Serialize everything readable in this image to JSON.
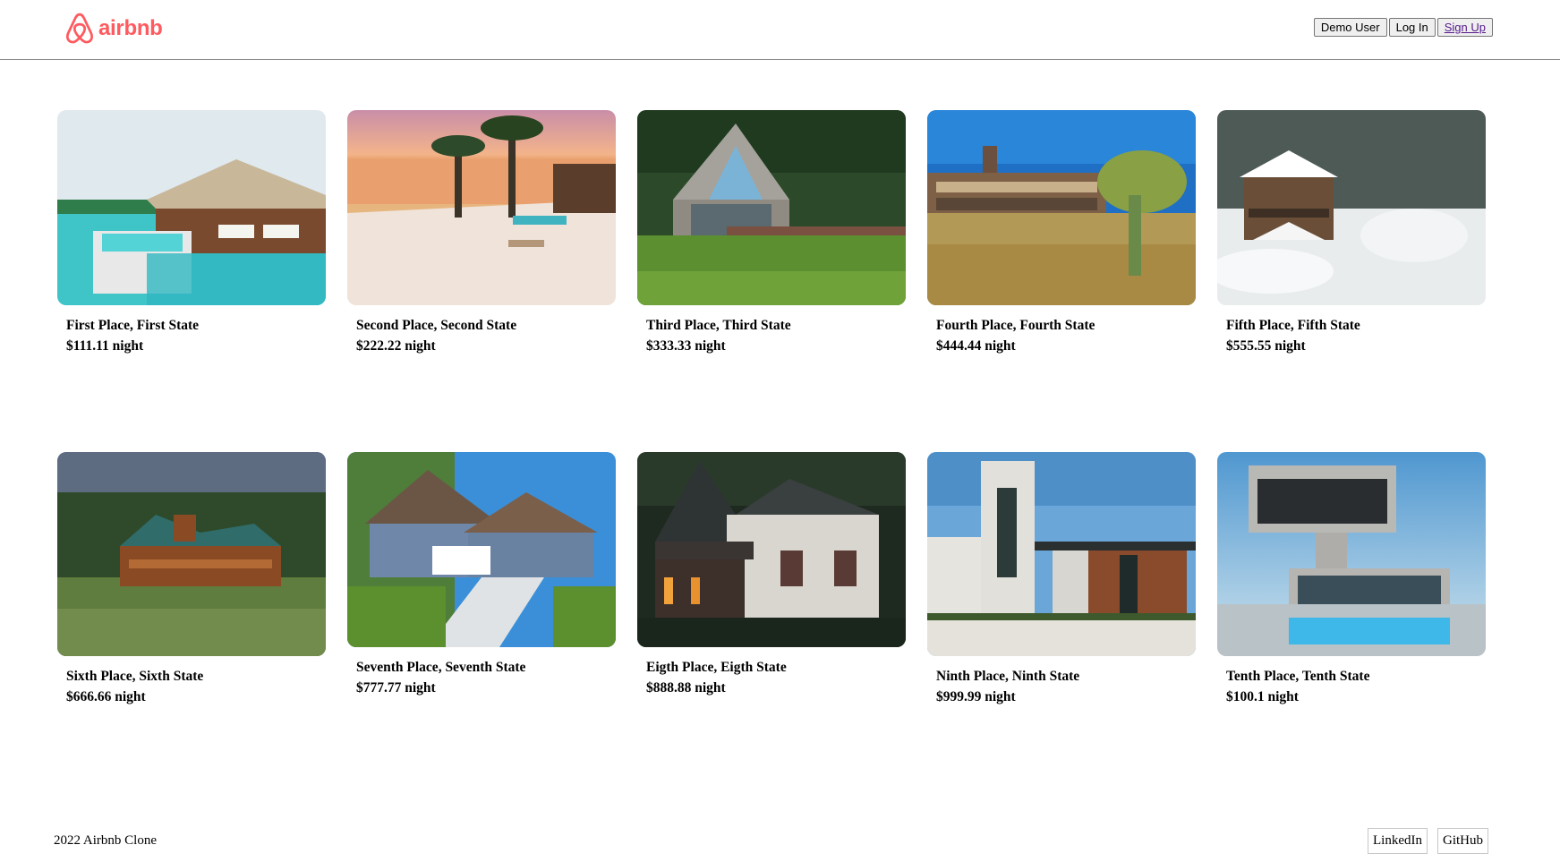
{
  "header": {
    "logo_text": "airbnb",
    "brand_color": "#ff5a5f",
    "buttons": {
      "demo_user": "Demo User",
      "log_in": "Log In",
      "sign_up": "Sign Up"
    }
  },
  "listings": [
    {
      "title": "First Place, First State",
      "price": "$111.11 night",
      "image": "overwater-bungalow"
    },
    {
      "title": "Second Place, Second State",
      "price": "$222.22 night",
      "image": "beach-sunset"
    },
    {
      "title": "Third Place, Third State",
      "price": "$333.33 night",
      "image": "modern-cabin-forest"
    },
    {
      "title": "Fourth Place, Fourth State",
      "price": "$444.44 night",
      "image": "desert-house"
    },
    {
      "title": "Fifth Place, Fifth State",
      "price": "$555.55 night",
      "image": "snowy-chalet"
    },
    {
      "title": "Sixth Place, Sixth State",
      "price": "$666.66 night",
      "image": "log-lodge"
    },
    {
      "title": "Seventh Place, Seventh State",
      "price": "$777.77 night",
      "image": "blue-suburban-house"
    },
    {
      "title": "Eigth Place, Eigth State",
      "price": "$888.88 night",
      "image": "old-farmhouse"
    },
    {
      "title": "Ninth Place, Ninth State",
      "price": "$999.99 night",
      "image": "modern-wood-house"
    },
    {
      "title": "Tenth Place, Tenth State",
      "price": "$100.1 night",
      "image": "cantilever-pool-house"
    }
  ],
  "footer": {
    "copyright": "2022 Airbnb Clone",
    "linkedin": "LinkedIn",
    "github": "GitHub"
  }
}
